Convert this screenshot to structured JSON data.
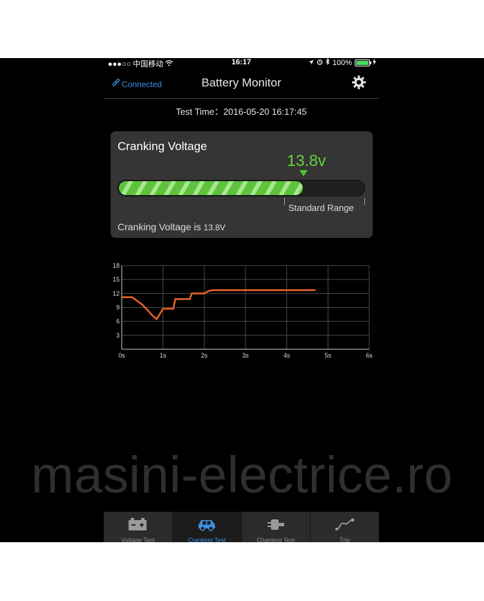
{
  "status_bar": {
    "signal": "●●●○○",
    "carrier": "中国移动",
    "time": "16:17",
    "battery": "100%"
  },
  "header": {
    "connection": "Connected",
    "title": "Battery Monitor",
    "settings_icon": "gear-icon"
  },
  "test_time": "Test Time：2016-05-20 16:17:45",
  "card": {
    "title": "Cranking Voltage",
    "value": "13.8v",
    "fill_fraction": 0.75,
    "range_label": "Standard Range",
    "footer_text": "Cranking Voltage is ",
    "footer_value": "13.8V"
  },
  "chart_data": {
    "type": "line",
    "title": "",
    "xlabel": "",
    "ylabel": "",
    "x_ticks": [
      "0s",
      "1s",
      "2s",
      "3s",
      "4s",
      "5s",
      "6s"
    ],
    "y_ticks": [
      "18",
      "15",
      "12",
      "9",
      "6",
      "3"
    ],
    "xlim": [
      0,
      6
    ],
    "ylim": [
      0,
      18
    ],
    "grid": true,
    "color": "#e0602a",
    "series": [
      {
        "x": [
          0,
          0.25,
          0.5,
          0.65,
          0.75,
          0.85,
          1.0,
          1.25,
          1.3,
          1.65,
          1.7,
          2.0,
          2.1,
          2.2,
          4.2,
          4.7
        ],
        "y": [
          11.2,
          11.2,
          9.6,
          8.2,
          7.2,
          6.5,
          8.7,
          8.7,
          10.8,
          10.8,
          12.0,
          12.0,
          12.5,
          12.7,
          12.7,
          12.7
        ]
      }
    ]
  },
  "watermark": "masini-electrice.ro",
  "tabs": [
    {
      "label": "Voltage Test",
      "icon": "battery-icon",
      "active": false
    },
    {
      "label": "Cranking Test",
      "icon": "car-icon",
      "active": true
    },
    {
      "label": "Charging Test",
      "icon": "plug-icon",
      "active": false
    },
    {
      "label": "Trip",
      "icon": "route-icon",
      "active": false
    }
  ]
}
